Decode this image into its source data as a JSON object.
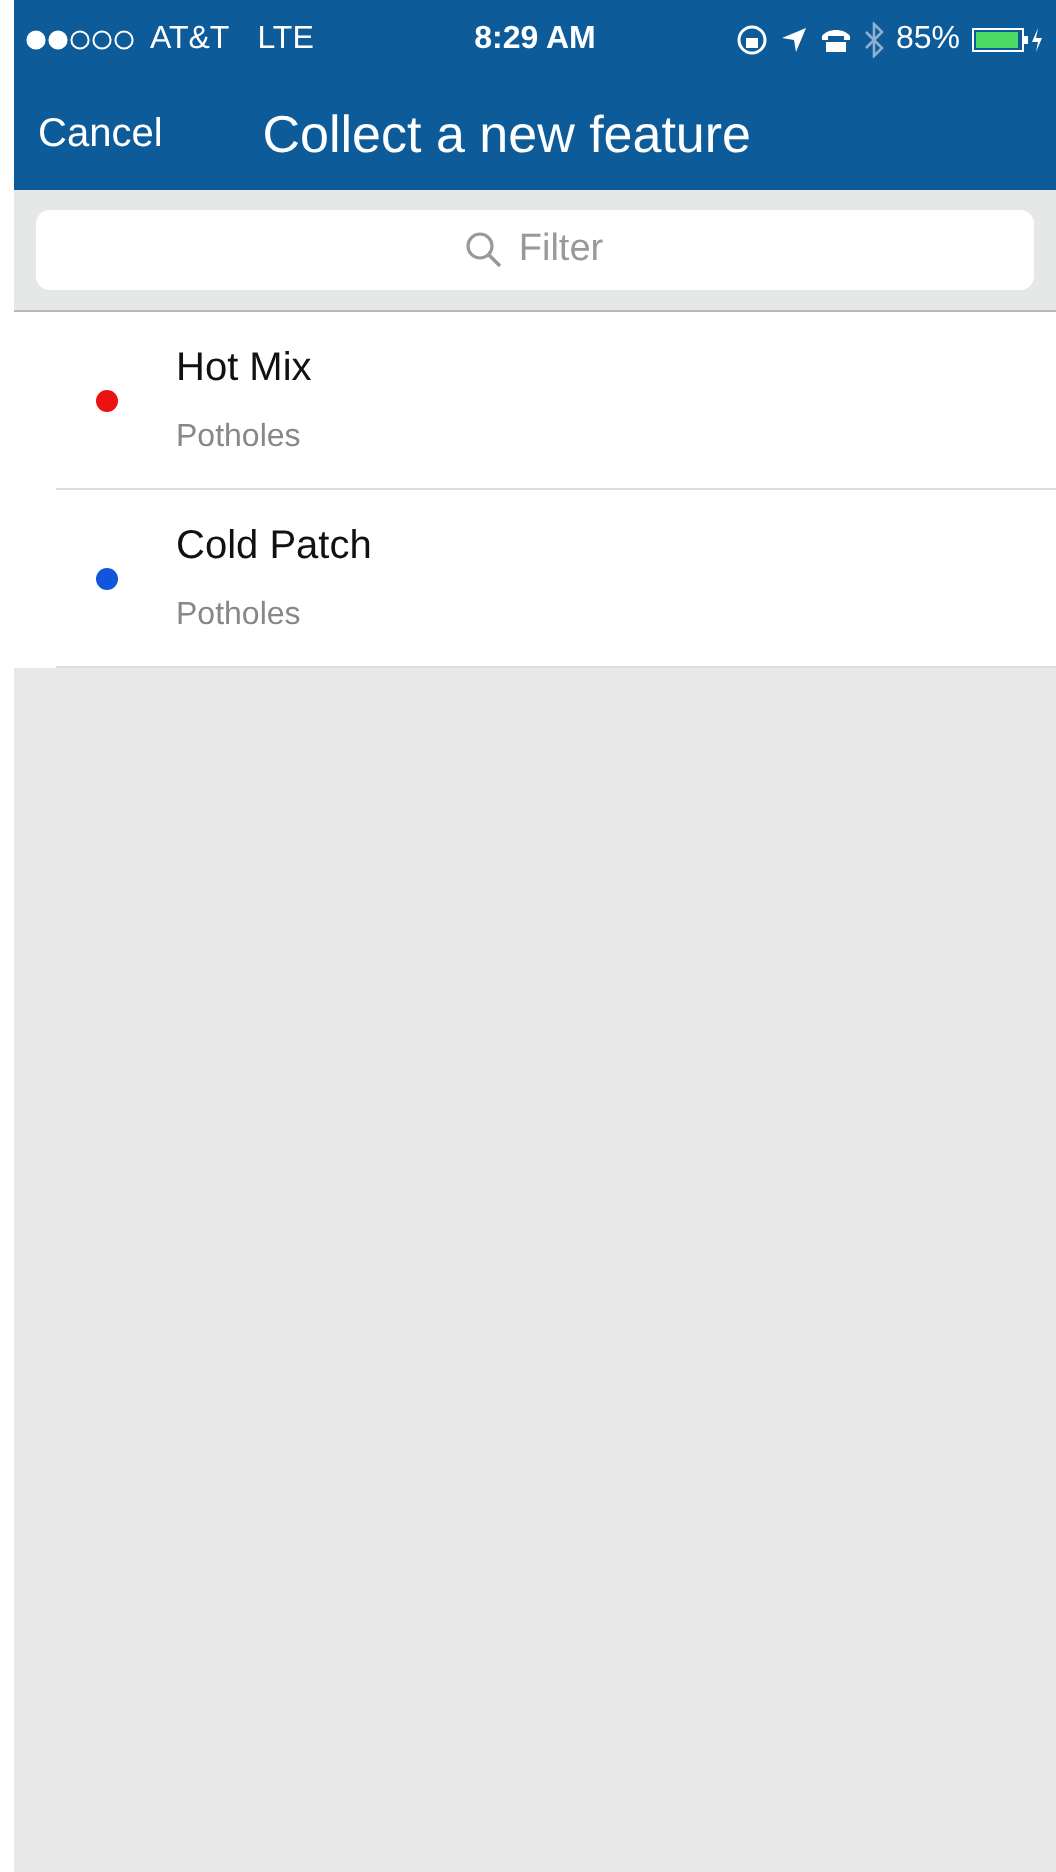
{
  "status_bar": {
    "carrier": "AT&T",
    "network": "LTE",
    "time": "8:29 AM",
    "battery": "85%"
  },
  "nav_bar": {
    "cancel": "Cancel",
    "title": "Collect a new feature"
  },
  "search": {
    "placeholder": "Filter"
  },
  "features": [
    {
      "name": "Hot Mix",
      "layer": "Potholes",
      "color": "#ee1111"
    },
    {
      "name": "Cold Patch",
      "layer": "Potholes",
      "color": "#1155dd"
    }
  ]
}
